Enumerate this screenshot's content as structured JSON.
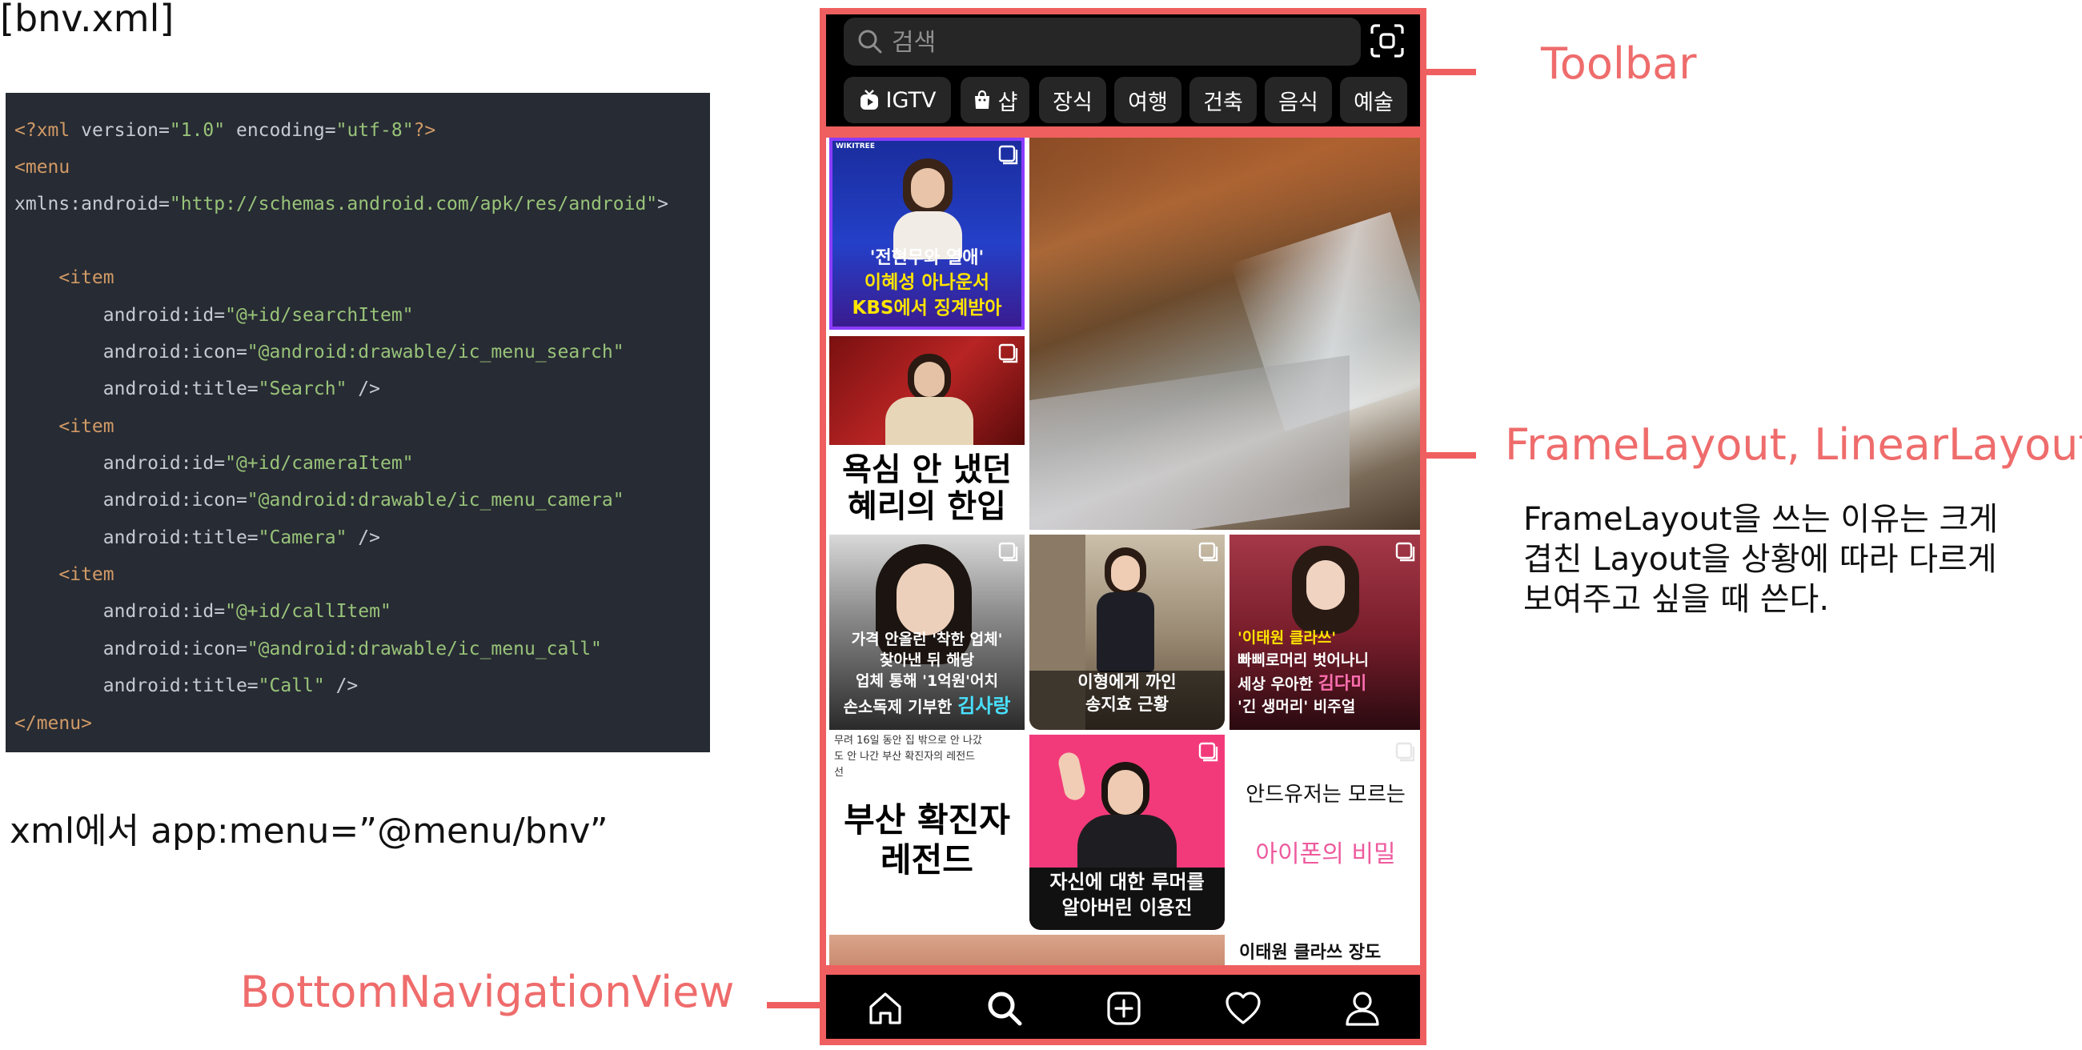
{
  "left": {
    "file_label": "[bnv.xml]",
    "code_lines": [
      [
        {
          "t": "<?xml ",
          "c": "y"
        },
        {
          "t": "version=",
          "c": "w"
        },
        {
          "t": "\"1.0\"",
          "c": "s"
        },
        {
          "t": " encoding=",
          "c": "w"
        },
        {
          "t": "\"utf-8\"",
          "c": "s"
        },
        {
          "t": "?>",
          "c": "y"
        }
      ],
      [
        {
          "t": "<menu",
          "c": "y"
        }
      ],
      [
        {
          "t": "xmlns:android=",
          "c": "w"
        },
        {
          "t": "\"http://schemas.android.com/apk/res/android\"",
          "c": "s"
        },
        {
          "t": ">",
          "c": "w"
        }
      ],
      [],
      [
        {
          "t": "    <item",
          "c": "y"
        }
      ],
      [
        {
          "t": "        android:id=",
          "c": "w"
        },
        {
          "t": "\"@+id/searchItem\"",
          "c": "s"
        }
      ],
      [
        {
          "t": "        android:icon=",
          "c": "w"
        },
        {
          "t": "\"@android:drawable/ic_menu_search\"",
          "c": "s"
        }
      ],
      [
        {
          "t": "        android:title=",
          "c": "w"
        },
        {
          "t": "\"Search\"",
          "c": "s"
        },
        {
          "t": " />",
          "c": "w"
        }
      ],
      [
        {
          "t": "    <item",
          "c": "y"
        }
      ],
      [
        {
          "t": "        android:id=",
          "c": "w"
        },
        {
          "t": "\"@+id/cameraItem\"",
          "c": "s"
        }
      ],
      [
        {
          "t": "        android:icon=",
          "c": "w"
        },
        {
          "t": "\"@android:drawable/ic_menu_camera\"",
          "c": "s"
        }
      ],
      [
        {
          "t": "        android:title=",
          "c": "w"
        },
        {
          "t": "\"Camera\"",
          "c": "s"
        },
        {
          "t": " />",
          "c": "w"
        }
      ],
      [
        {
          "t": "    <item",
          "c": "y"
        }
      ],
      [
        {
          "t": "        android:id=",
          "c": "w"
        },
        {
          "t": "\"@+id/callItem\"",
          "c": "s"
        }
      ],
      [
        {
          "t": "        android:icon=",
          "c": "w"
        },
        {
          "t": "\"@android:drawable/ic_menu_call\"",
          "c": "s"
        }
      ],
      [
        {
          "t": "        android:title=",
          "c": "w"
        },
        {
          "t": "\"Call\"",
          "c": "s"
        },
        {
          "t": " />",
          "c": "w"
        }
      ],
      [
        {
          "t": "</menu>",
          "c": "y"
        }
      ]
    ],
    "xml_note": "xml에서 app:menu=”@menu/bnv”",
    "bnv_label": "BottomNavigationView"
  },
  "annotations": {
    "toolbar": "Toolbar",
    "frame": "FrameLayout, LinearLayout",
    "explain_lines": [
      "FrameLayout을 쓰는 이유는 크게",
      "겹친 Layout을 상황에 따라 다르게",
      "보여주고 싶을 때 쓴다."
    ]
  },
  "phone": {
    "search_placeholder": "검색",
    "chips": [
      {
        "label": "IGTV",
        "icon": "igtv-icon"
      },
      {
        "label": "샵",
        "icon": "shop-bag-icon"
      },
      {
        "label": "장식"
      },
      {
        "label": "여행"
      },
      {
        "label": "건축"
      },
      {
        "label": "음식"
      },
      {
        "label": "예술"
      }
    ],
    "tiles": {
      "t1_brand": "WIKITREE",
      "t1_line1": "'전현무와 열애'",
      "t1_line2": "이혜성 아나운서",
      "t1_line3": "KBS에서 징계받아",
      "t2_line1": "욕심 안 냈던",
      "t2_line2": "혜리의 한입",
      "t3_line1": "가격 안올린 '착한 업체'",
      "t3_line2": "찾아낸 뒤 해당",
      "t3_line3": "업체 통해 '1억원'어치",
      "t3_line4a": "손소독제 기부한 ",
      "t3_line4b": "김사랑",
      "t4_line1": "이형에게 까인",
      "t4_line2": "송지효 근황",
      "t5_line1": "'이태원 클라쓰'",
      "t5_line2": "빠삐로머리 벗어나니",
      "t5_line3a": "세상 우아한 ",
      "t5_line3b": "김다미",
      "t5_line4": "'긴 생머리' 비주얼",
      "t6_top1": "무려 16일 동안 집 밖으로 안 나갔",
      "t6_top2": "도 안 나간 부산 확진자의 레전드",
      "t6_top3": "선",
      "t6_line1": "부산 확진자",
      "t6_line2": "레전드",
      "t7_line1": "자신에 대한 루머를",
      "t7_line2": "알아버린 이용진",
      "t8_line1": "안드유저는 모르는",
      "t8_line2": "아이폰의 비밀",
      "t9_line1": "이태원 클라쓰 장도"
    },
    "nav_items": [
      "home-icon",
      "search-icon",
      "add-post-icon",
      "heart-icon",
      "profile-icon"
    ]
  },
  "colors": {
    "annotation_red": "#ef5f5f",
    "code_bg": "#272b33",
    "accent_yellow": "#ffe400",
    "accent_cyan": "#49e0ff",
    "accent_pink": "#ff6fb0",
    "pink_text": "#ee5a9d"
  }
}
